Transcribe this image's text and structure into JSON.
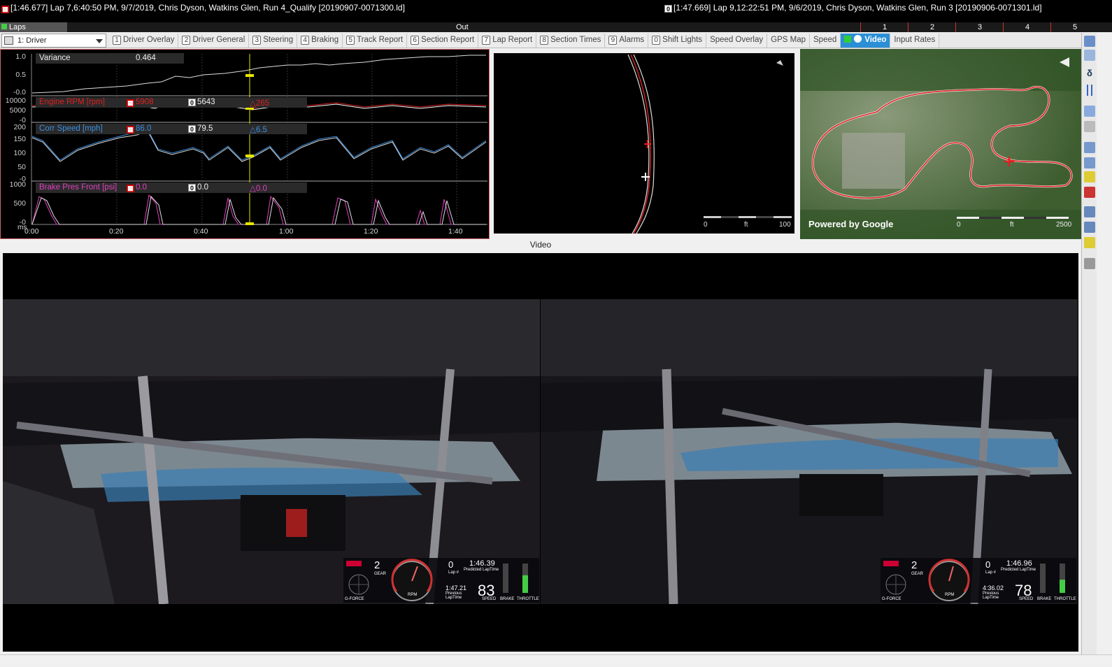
{
  "title_bar": {
    "left": "[1:46.677] Lap 7,6:40:50 PM, 9/7/2019,  Chris Dyson, Watkins Glen, Run 4_Qualify [20190907-0071300.ld]",
    "left_badge": "▦",
    "right": "[1:47.669] Lap 9,12:22:51 PM, 9/6/2019,  Chris Dyson, Watkins Glen, Run 3 [20190906-0071301.ld]",
    "right_badge": "0"
  },
  "lap_bar": {
    "label": "Laps",
    "out_label": "Out",
    "laps": [
      "1",
      "2",
      "3",
      "4",
      "5"
    ]
  },
  "workspace": {
    "selected": "1: Driver"
  },
  "tabs": [
    {
      "num": "1",
      "label": "Driver Overlay"
    },
    {
      "num": "2",
      "label": "Driver General"
    },
    {
      "num": "3",
      "label": "Steering"
    },
    {
      "num": "4",
      "label": "Braking"
    },
    {
      "num": "5",
      "label": "Track Report"
    },
    {
      "num": "6",
      "label": "Section Report"
    },
    {
      "num": "7",
      "label": "Lap Report"
    },
    {
      "num": "8",
      "label": "Section Times"
    },
    {
      "num": "9",
      "label": "Alarms"
    },
    {
      "num": "0",
      "label": "Shift Lights"
    },
    {
      "num": "",
      "label": "Speed Overlay"
    },
    {
      "num": "",
      "label": "GPS Map"
    },
    {
      "num": "",
      "label": "Speed"
    },
    {
      "num": "",
      "label": "Video",
      "active": true
    },
    {
      "num": "",
      "label": "Input Rates"
    }
  ],
  "channels": {
    "variance": {
      "name": "Variance",
      "value": "0.464",
      "ticks": [
        "1.0",
        "0.5",
        "-0.0"
      ]
    },
    "rpm": {
      "name": "Engine RPM [rpm]",
      "v1": "5908",
      "v2": "5643",
      "delta": "265",
      "ticks": [
        "10000",
        "5000",
        "-0"
      ],
      "color": "#e02020"
    },
    "speed": {
      "name": "Corr Speed [mph]",
      "v1": "86.0",
      "v2": "79.5",
      "delta": "6.5",
      "ticks": [
        "200",
        "150",
        "100",
        "50",
        "-0"
      ],
      "color": "#3a8fe0"
    },
    "brake": {
      "name": "Brake Pres Front [psi]",
      "v1": "0.0",
      "v2": "0.0",
      "delta": "0.0",
      "ticks": [
        "1000",
        "500",
        "-0"
      ],
      "color": "#e040c0"
    }
  },
  "x_axis": {
    "unit": "ms",
    "ticks": [
      "0:00",
      "0:20",
      "0:40",
      "1:00",
      "1:20",
      "1:40"
    ]
  },
  "track_scale": {
    "min": "0",
    "unit": "ft",
    "max": "100"
  },
  "map": {
    "attribution": "Powered by Google",
    "scale_min": "0",
    "scale_unit": "ft",
    "scale_max": "2500"
  },
  "video": {
    "label": "Video",
    "left_hud": {
      "gear": "2",
      "gear_label": "GEAR",
      "lap": "0",
      "lap_label": "Lap #",
      "predicted": "1:46.39",
      "predicted_label": "Predicted LapTime",
      "previous": "1:47.21",
      "previous_label": "Previous LapTime",
      "speed": "83",
      "speed_label": "SPEED",
      "brake_label": "BRAKE",
      "throttle_label": "THROTTLE",
      "gforce_label": "G-FORCE",
      "rpm_label": "RPM",
      "throttle_pct": 0.6
    },
    "right_hud": {
      "gear": "2",
      "gear_label": "GEAR",
      "lap": "0",
      "lap_label": "Lap #",
      "predicted": "1:46.96",
      "predicted_label": "Predicted LapTime",
      "previous": "4:36.02",
      "previous_label": "Previous LapTime",
      "speed": "78",
      "speed_label": "SPEED",
      "brake_label": "BRAKE",
      "throttle_label": "THROTTLE",
      "gforce_label": "G-FORCE",
      "rpm_label": "RPM",
      "throttle_pct": 0.45
    }
  }
}
